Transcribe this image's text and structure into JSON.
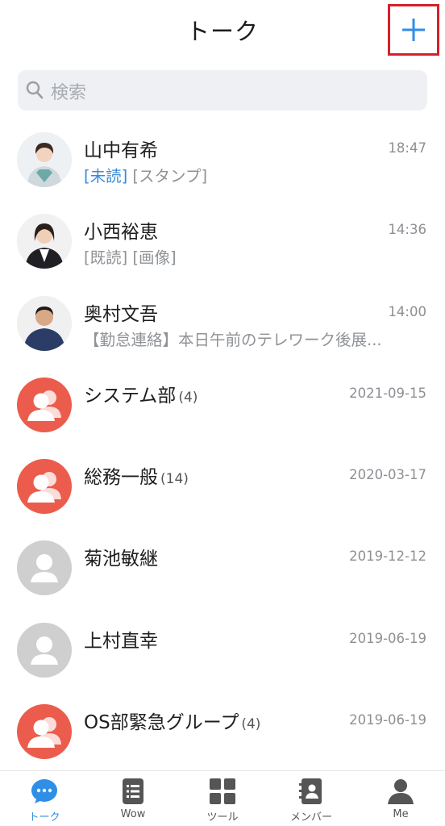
{
  "header": {
    "title": "トーク",
    "add_icon": "plus-icon"
  },
  "search": {
    "placeholder": "検索",
    "icon": "search-icon"
  },
  "conversations": [
    {
      "name": "山中有希",
      "count": "",
      "time": "18:47",
      "status": "[未読]",
      "preview": " [スタンプ]",
      "avatar": "photo-woman"
    },
    {
      "name": "小西裕恵",
      "count": "",
      "time": "14:36",
      "status": "",
      "preview": "[既読] [画像]",
      "avatar": "photo-woman"
    },
    {
      "name": "奥村文吾",
      "count": "",
      "time": "14:00",
      "status": "",
      "preview": "【勤怠連絡】本日午前のテレワーク後展...",
      "avatar": "photo-man"
    },
    {
      "name": "システム部",
      "count": "(4)",
      "time": "2021-09-15",
      "status": "",
      "preview": "",
      "avatar": "group"
    },
    {
      "name": "総務一般",
      "count": "(14)",
      "time": "2020-03-17",
      "status": "",
      "preview": "",
      "avatar": "group"
    },
    {
      "name": "菊池敏継",
      "count": "",
      "time": "2019-12-12",
      "status": "",
      "preview": "",
      "avatar": "user"
    },
    {
      "name": "上村直幸",
      "count": "",
      "time": "2019-06-19",
      "status": "",
      "preview": "",
      "avatar": "user"
    },
    {
      "name": "OS部緊急グループ",
      "count": "(4)",
      "time": "2019-06-19",
      "status": "",
      "preview": "",
      "avatar": "group"
    }
  ],
  "tabs": [
    {
      "label": "トーク",
      "icon": "chat-bubble-icon",
      "active": true
    },
    {
      "label": "Wow",
      "icon": "list-icon",
      "active": false
    },
    {
      "label": "ツール",
      "icon": "grid-icon",
      "active": false
    },
    {
      "label": "メンバー",
      "icon": "contacts-icon",
      "active": false
    },
    {
      "label": "Me",
      "icon": "person-icon",
      "active": false
    }
  ],
  "colors": {
    "accent": "#2f8ee6",
    "group_avatar": "#ec5c4c",
    "user_avatar": "#cfcfcf",
    "highlight_border": "#d6202a"
  }
}
